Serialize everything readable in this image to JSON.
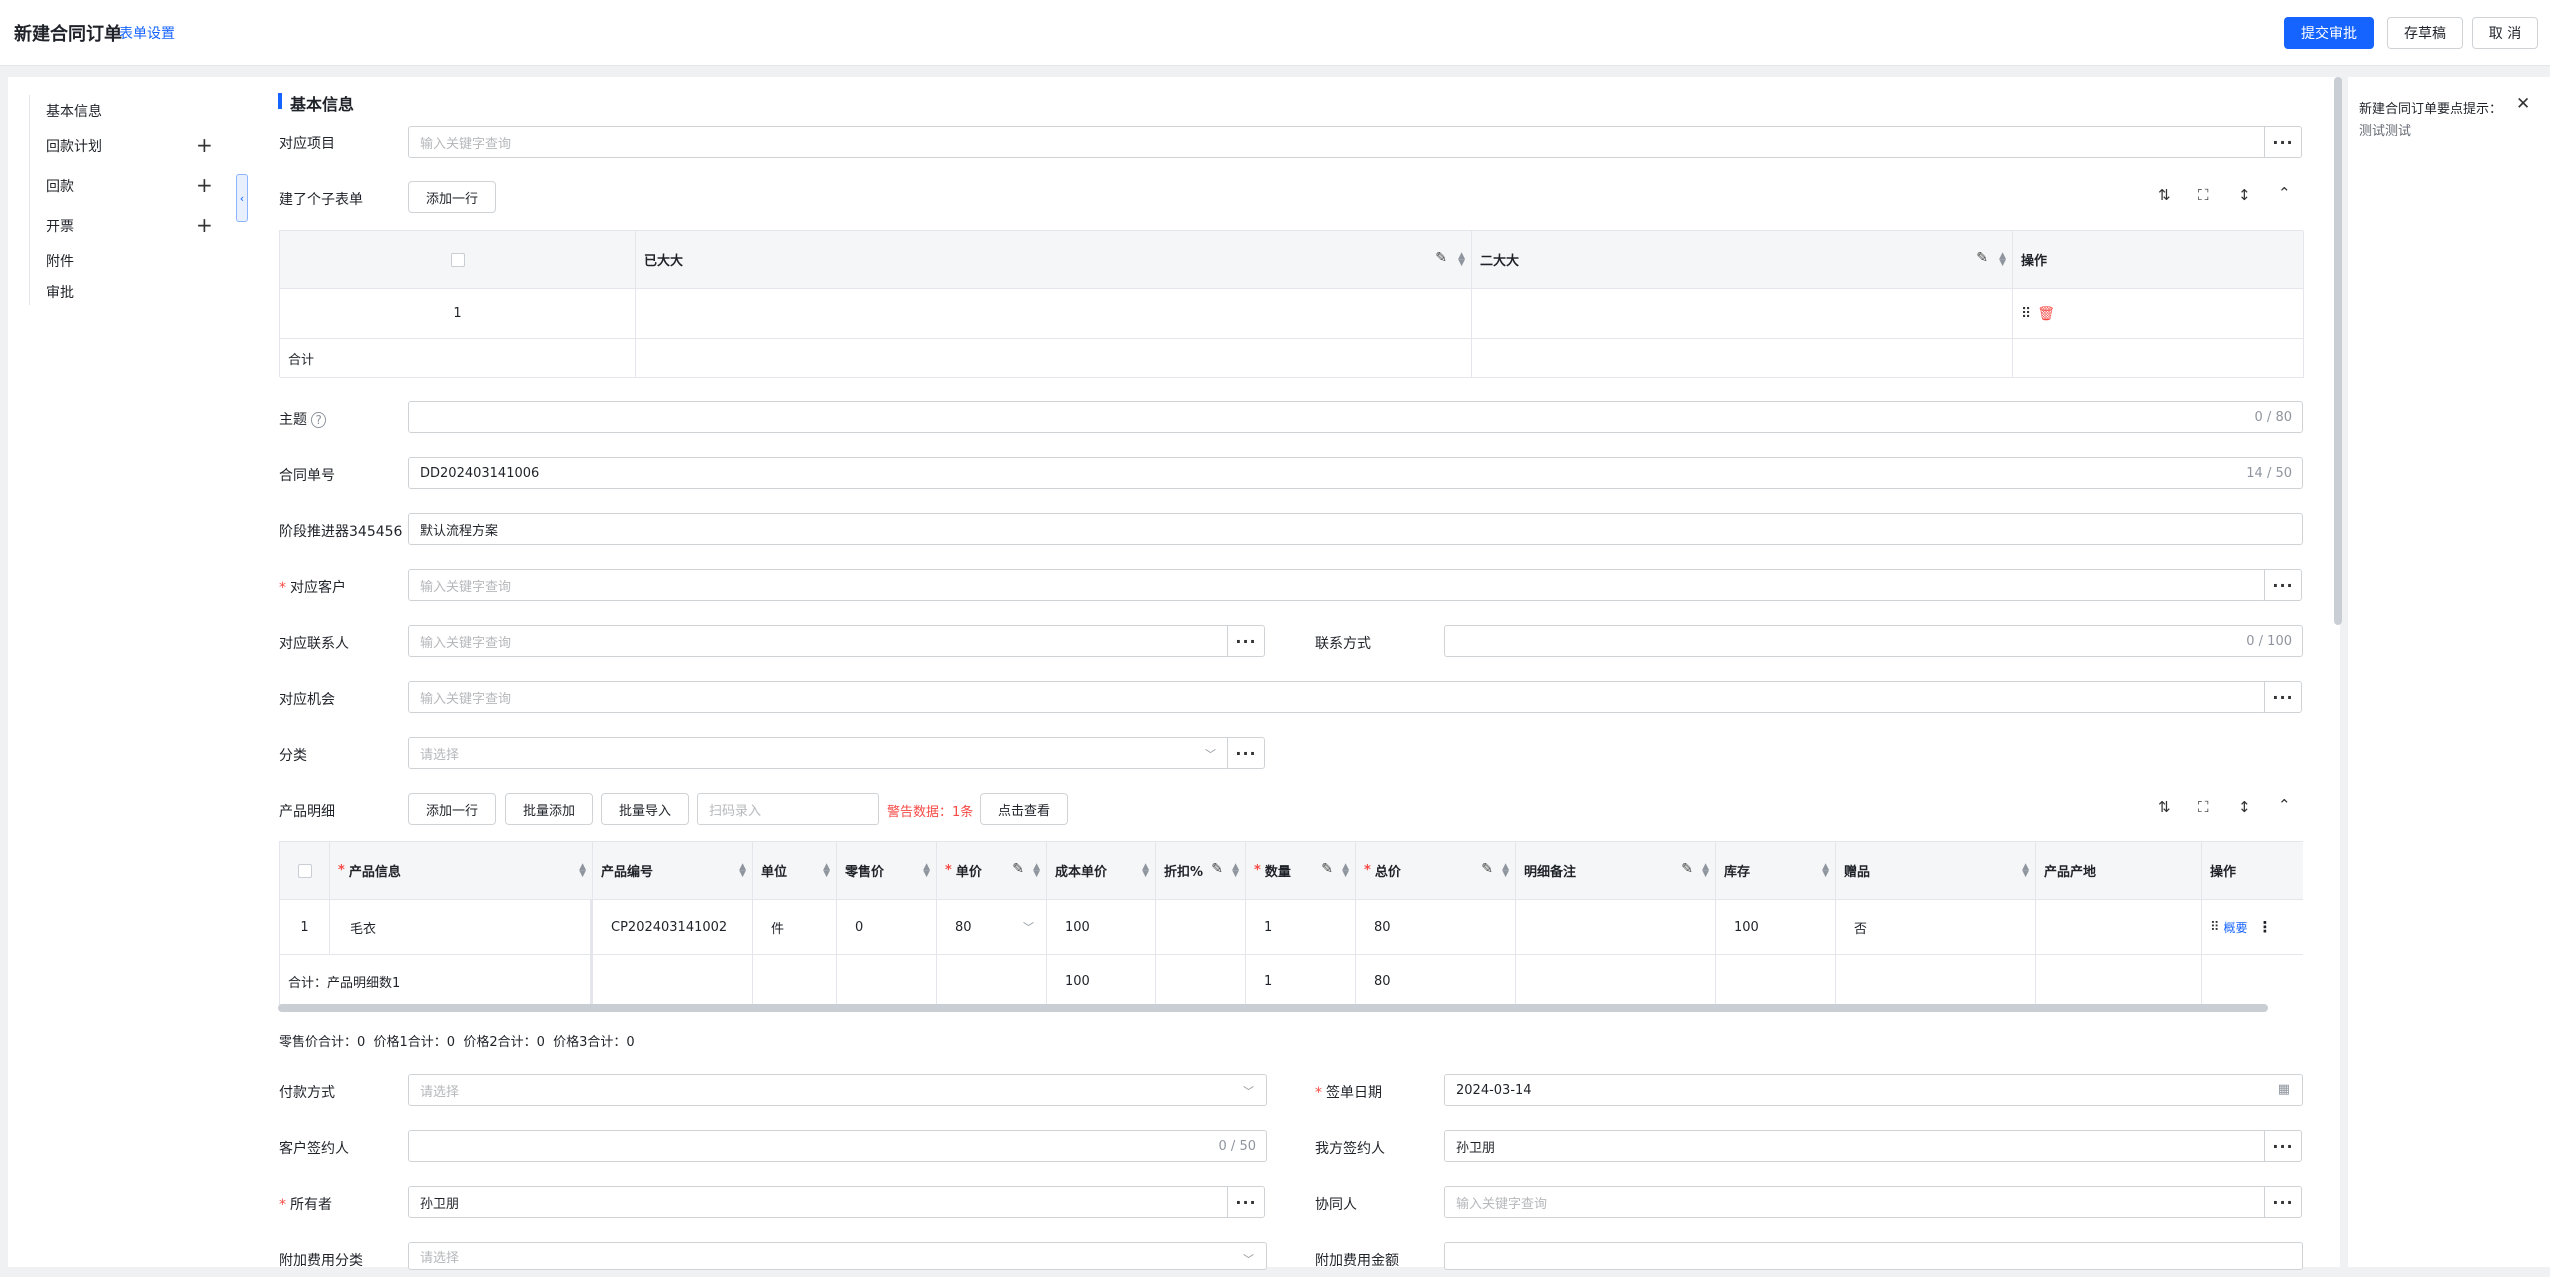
{
  "header": {
    "title": "新建合同订单",
    "form_settings": "表单设置",
    "submit": "提交审批",
    "draft": "存草稿",
    "cancel": "取 消"
  },
  "nav": {
    "items": [
      "基本信息",
      "回款计划",
      "回款",
      "开票",
      "附件",
      "审批"
    ]
  },
  "section": {
    "basic": "基本信息"
  },
  "form": {
    "project_label": "对应项目",
    "project_placeholder": "输入关键字查询",
    "subform_label": "建了个子表单",
    "add_row": "添加一行",
    "subject_label": "主题",
    "subject_count": "0 / 80",
    "order_no_label": "合同单号",
    "order_no_value": "DD202403141006",
    "order_no_count": "14 / 50",
    "stage_label": "阶段推进器345456",
    "stage_value": "默认流程方案",
    "customer_label": "对应客户",
    "customer_placeholder": "输入关键字查询",
    "contact_label": "对应联系人",
    "contact_placeholder": "输入关键字查询",
    "phone_label": "联系方式",
    "phone_count": "0 / 100",
    "opportunity_label": "对应机会",
    "opportunity_placeholder": "输入关键字查询",
    "category_label": "分类",
    "category_placeholder": "请选择",
    "product_label": "产品明细",
    "batch_add": "批量添加",
    "batch_import": "批量导入",
    "scan_placeholder": "扫码录入",
    "warning_text": "警告数据：1条",
    "view_btn": "点击查看",
    "summary_line": "零售价合计：0  价格1合计：0  价格2合计：0  价格3合计：0",
    "payment_label": "付款方式",
    "payment_placeholder": "请选择",
    "sign_date_label": "签单日期",
    "sign_date_value": "2024-03-14",
    "cust_signer_label": "客户签约人",
    "cust_signer_count": "0 / 50",
    "our_signer_label": "我方签约人",
    "our_signer_value": "孙卫朋",
    "owner_label": "所有者",
    "owner_value": "孙卫朋",
    "collab_label": "协同人",
    "collab_placeholder": "输入关键字查询",
    "extra_cat_label": "附加费用分类",
    "extra_cat_placeholder": "请选择",
    "extra_amt_label": "附加费用金额"
  },
  "subtable": {
    "headers": [
      "已大大",
      "二大大",
      "操作"
    ],
    "row_index": "1",
    "total": "合计"
  },
  "product_table": {
    "headers": [
      "产品信息",
      "产品编号",
      "单位",
      "零售价",
      "单价",
      "成本单价",
      "折扣%",
      "数量",
      "总价",
      "明细备注",
      "库存",
      "赠品",
      "产品产地",
      "操作"
    ],
    "row": [
      "1",
      "毛衣",
      "CP202403141002",
      "件",
      "0",
      "80",
      "100",
      "",
      "1",
      "80",
      "",
      "100",
      "否",
      "",
      "概要"
    ],
    "total_label": "合计：产品明细数1",
    "total_cost": "100",
    "total_qty": "1",
    "total_price": "80"
  },
  "tip": {
    "title": "新建合同订单要点提示：",
    "body": "测试测试"
  }
}
